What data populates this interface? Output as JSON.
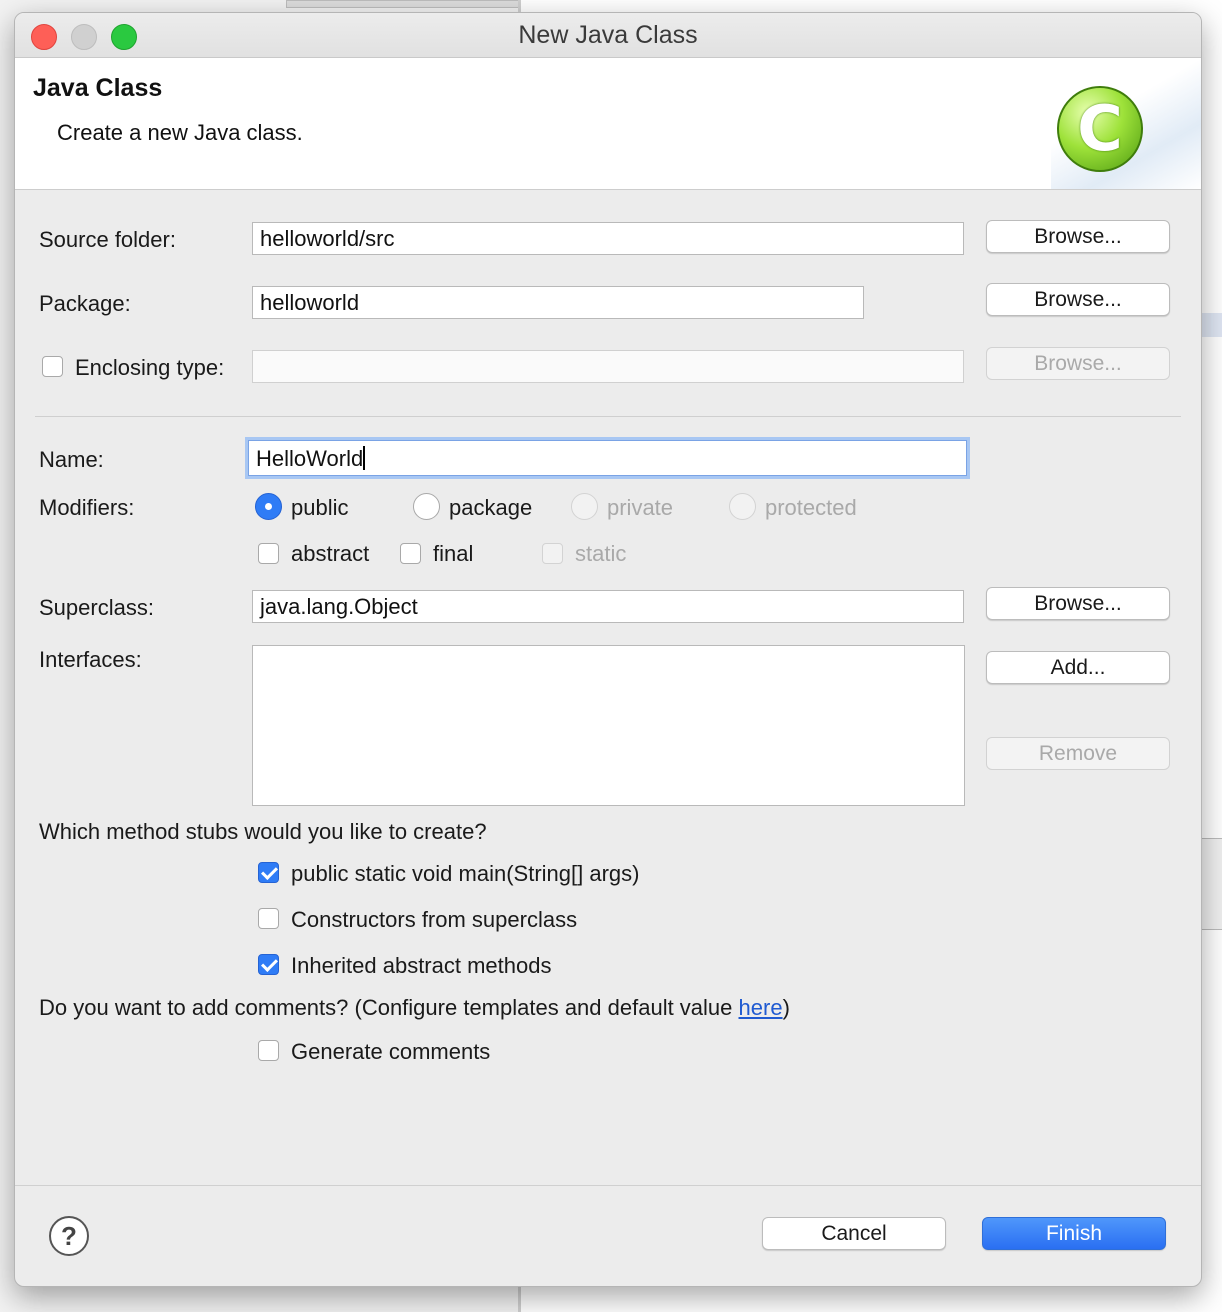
{
  "window": {
    "title": "New Java Class"
  },
  "header": {
    "title": "Java Class",
    "subtitle": "Create a new Java class.",
    "logo_icon": "java-class-icon",
    "logo_glyph": "C"
  },
  "source_folder": {
    "label": "Source folder:",
    "value": "helloworld/src",
    "browse": "Browse..."
  },
  "package": {
    "label": "Package:",
    "value": "helloworld",
    "browse": "Browse..."
  },
  "enclosing_type": {
    "label": "Enclosing type:",
    "checked": false,
    "value": "",
    "browse": "Browse..."
  },
  "name": {
    "label": "Name:",
    "value": "HelloWorld"
  },
  "modifiers": {
    "label": "Modifiers:",
    "access": [
      {
        "label": "public",
        "selected": true,
        "enabled": true
      },
      {
        "label": "package",
        "selected": false,
        "enabled": true
      },
      {
        "label": "private",
        "selected": false,
        "enabled": false
      },
      {
        "label": "protected",
        "selected": false,
        "enabled": false
      }
    ],
    "flags": [
      {
        "label": "abstract",
        "checked": false,
        "enabled": true
      },
      {
        "label": "final",
        "checked": false,
        "enabled": true
      },
      {
        "label": "static",
        "checked": false,
        "enabled": false
      }
    ]
  },
  "superclass": {
    "label": "Superclass:",
    "value": "java.lang.Object",
    "browse": "Browse..."
  },
  "interfaces": {
    "label": "Interfaces:",
    "items": [],
    "add": "Add...",
    "remove": "Remove"
  },
  "stubs": {
    "question": "Which method stubs would you like to create?",
    "options": [
      {
        "label": "public static void main(String[] args)",
        "checked": true
      },
      {
        "label": "Constructors from superclass",
        "checked": false
      },
      {
        "label": "Inherited abstract methods",
        "checked": true
      }
    ]
  },
  "comments": {
    "question_prefix": "Do you want to add comments? (Configure templates and default value ",
    "link": "here",
    "question_suffix": ")",
    "option": {
      "label": "Generate comments",
      "checked": false
    }
  },
  "footer": {
    "help": "?",
    "cancel": "Cancel",
    "finish": "Finish"
  },
  "colors": {
    "accent": "#2f7cf6",
    "link": "#1f5ad1",
    "close": "#fe5f57",
    "maximize": "#2ac940"
  }
}
